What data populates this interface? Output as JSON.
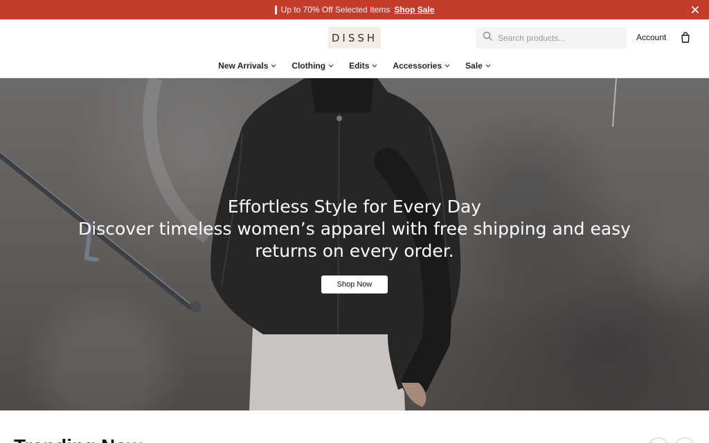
{
  "announcement": {
    "text": "Up to 70% Off Selected Items",
    "link_label": "Shop Sale",
    "close_icon": "close-icon"
  },
  "header": {
    "logo": "DISSH",
    "search_placeholder": "Search products...",
    "account_label": "Account",
    "bag_icon": "shopping-bag-icon"
  },
  "nav": {
    "items": [
      {
        "label": "New Arrivals"
      },
      {
        "label": "Clothing"
      },
      {
        "label": "Edits"
      },
      {
        "label": "Accessories"
      },
      {
        "label": "Sale"
      }
    ]
  },
  "hero": {
    "title": "Effortless Style for Every Day",
    "subtitle": "Discover timeless women’s apparel with free shipping and easy returns on every order.",
    "cta_label": "Shop Now"
  },
  "trending": {
    "heading": "Trending Now"
  },
  "colors": {
    "accent": "#c43c2c"
  }
}
